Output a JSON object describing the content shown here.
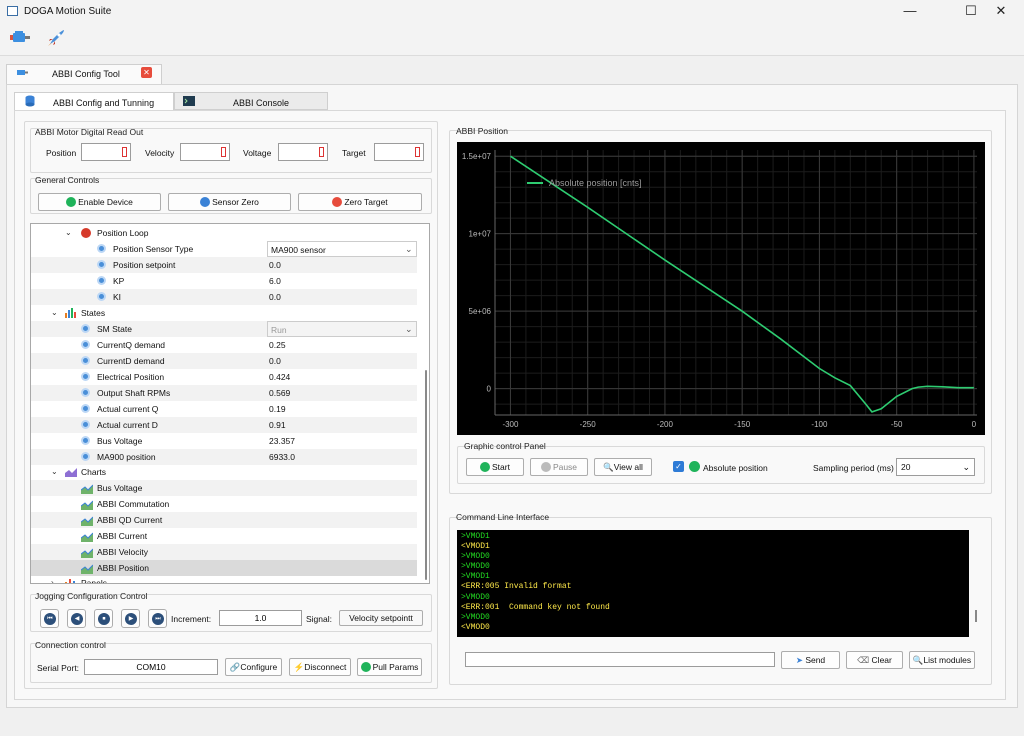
{
  "window": {
    "title": "DOGA Motion Suite",
    "controls": [
      "—",
      "☐",
      "✕"
    ]
  },
  "toolbar": {
    "tools": [
      "motor-icon",
      "rocket-icon"
    ]
  },
  "tabs": {
    "tool_tab": "ABBI Config Tool",
    "config_tab": "ABBI Config and Tunning",
    "console_tab": "ABBI Console"
  },
  "readout": {
    "title": "ABBI Motor Digital Read Out",
    "position": "Position",
    "velocity": "Velocity",
    "voltage": "Voltage",
    "target": "Target"
  },
  "general": {
    "title": "General Controls",
    "enable": "Enable Device",
    "sensor_zero": "Sensor Zero",
    "zero_target": "Zero Target"
  },
  "tree": {
    "position_loop": "Position Loop",
    "pl_items": [
      {
        "label": "Position Sensor Type",
        "value": "MA900 sensor"
      },
      {
        "label": "Position setpoint",
        "value": "0.0"
      },
      {
        "label": "KP",
        "value": "6.0"
      },
      {
        "label": "KI",
        "value": "0.0"
      }
    ],
    "states": "States",
    "state_items": [
      {
        "label": "SM State",
        "value": "Run"
      },
      {
        "label": "CurrentQ demand",
        "value": "0.25"
      },
      {
        "label": "CurrentD demand",
        "value": "0.0"
      },
      {
        "label": "Electrical Position",
        "value": "0.424"
      },
      {
        "label": "Output Shaft RPMs",
        "value": "0.569"
      },
      {
        "label": "Actual current Q",
        "value": "0.19"
      },
      {
        "label": "Actual current D",
        "value": "0.91"
      },
      {
        "label": "Bus Voltage",
        "value": "23.357"
      },
      {
        "label": "MA900 position",
        "value": "6933.0"
      }
    ],
    "charts": "Charts",
    "chart_items": [
      "Bus Voltage",
      "ABBI Commutation",
      "ABBI QD Current",
      "ABBI Current",
      "ABBI Velocity",
      "ABBI Position"
    ],
    "panels": "Panels"
  },
  "jogging": {
    "title": "Jogging Configuration Control",
    "buttons": [
      "⏮",
      "◀",
      "⏹",
      "▶",
      "⏭"
    ],
    "increment_label": "Increment:",
    "increment": "1.0",
    "signal_label": "Signal:",
    "signal": "Velocity setpointt"
  },
  "connection": {
    "title": "Connection control",
    "port_label": "Serial Port:",
    "port": "COM10",
    "configure": "Configure",
    "disconnect": "Disconnect",
    "pull": "Pull Params"
  },
  "plot_group": {
    "title": "ABBI Position"
  },
  "chart_data": {
    "type": "line",
    "legend": "Absolute position [cnts]",
    "legend_position": "top-left",
    "x_ticks": [
      "-300",
      "-250",
      "-200",
      "-150",
      "-100",
      "-50",
      "0"
    ],
    "y_ticks": [
      "1.5e+07",
      "1e+07",
      "5e+06",
      "0"
    ],
    "xlim": [
      -310,
      2
    ],
    "ylim": [
      -1700000,
      15400000
    ],
    "grid": true,
    "series": [
      {
        "color": "#2ecc71",
        "x": [
          -300,
          -250,
          -200,
          -150,
          -125,
          -100,
          -90,
          -80,
          -70,
          -66,
          -60,
          -50,
          -40,
          -36,
          -30,
          -20,
          -10,
          0
        ],
        "y": [
          15000000,
          11700000,
          8300000,
          5000000,
          3200000,
          1300000,
          700000,
          200000,
          -1000000,
          -1500000,
          -1300000,
          -500000,
          0,
          100000,
          150000,
          120000,
          60000,
          60000
        ]
      }
    ]
  },
  "graphic": {
    "title": "Graphic control Panel",
    "start": "Start",
    "pause": "Pause",
    "view_all": "View all",
    "absolute": "Absolute position",
    "sampling_label": "Sampling period (ms)",
    "sampling": "20"
  },
  "cli": {
    "title": "Command Line Interface",
    "lines": [
      {
        "t": ">VMOD1",
        "c": "#22dd22"
      },
      {
        "t": "<VMOD1",
        "c": "#ffe94a"
      },
      {
        "t": ">VMOD0",
        "c": "#22dd22"
      },
      {
        "t": ">VMOD0",
        "c": "#22dd22"
      },
      {
        "t": ">VMOD1",
        "c": "#22dd22"
      },
      {
        "t": "<ERR:005 Invalid format",
        "c": "#ffe94a"
      },
      {
        "t": ">VMOD0",
        "c": "#22dd22"
      },
      {
        "t": "<ERR:001  Command key not found",
        "c": "#ffe94a"
      },
      {
        "t": ">VMOD0",
        "c": "#22dd22"
      },
      {
        "t": "<VMOD0",
        "c": "#ffe94a"
      }
    ],
    "send": "Send",
    "clear": "Clear",
    "list": "List modules"
  },
  "colors": {
    "accent": "#2e7bd6",
    "plot_line": "#2ecc71",
    "cli_bg": "#000000"
  }
}
